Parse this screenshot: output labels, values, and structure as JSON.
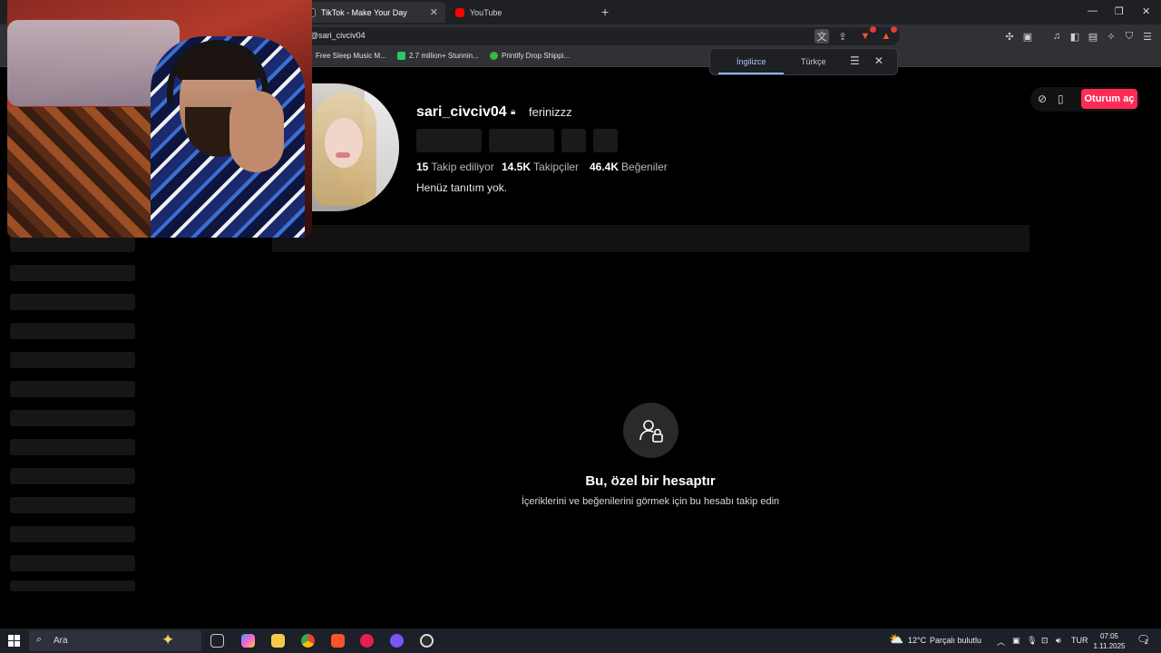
{
  "browser": {
    "tabs": [
      {
        "label": "TikTok - Make Your Day",
        "active": true
      },
      {
        "label": "YouTube",
        "active": false
      }
    ],
    "url": "@sari_civciv04",
    "bookmarks": [
      "Free Sleep Music M...",
      "2.7 million+ Stunnin...",
      "Printify Drop Shippi..."
    ],
    "translate": {
      "lang_source": "İngilizce",
      "lang_target": "Türkçe"
    }
  },
  "header": {
    "login_label": "Oturum aç"
  },
  "profile": {
    "username": "sari_civciv04",
    "nickname": "ferinizzz",
    "following_count": "15",
    "following_label": "Takip ediliyor",
    "followers_count": "14.5K",
    "followers_label": "Takipçiler",
    "likes_count": "46.4K",
    "likes_label": "Beğeniler",
    "bio": "Henüz tanıtım yok."
  },
  "private": {
    "title": "Bu, özel bir hesaptır",
    "subtitle": "İçeriklerini ve beğenilerini görmek için bu hesabı takip edin"
  },
  "taskbar": {
    "search_label": "Ara",
    "weather_temp": "12°C",
    "weather_text": "Parçalı bulutlu",
    "language": "TUR",
    "time": "07:05",
    "date": "1.11.2025",
    "notification_count": "2"
  },
  "colors": {
    "accent": "#fe2c55",
    "background": "#000000"
  }
}
